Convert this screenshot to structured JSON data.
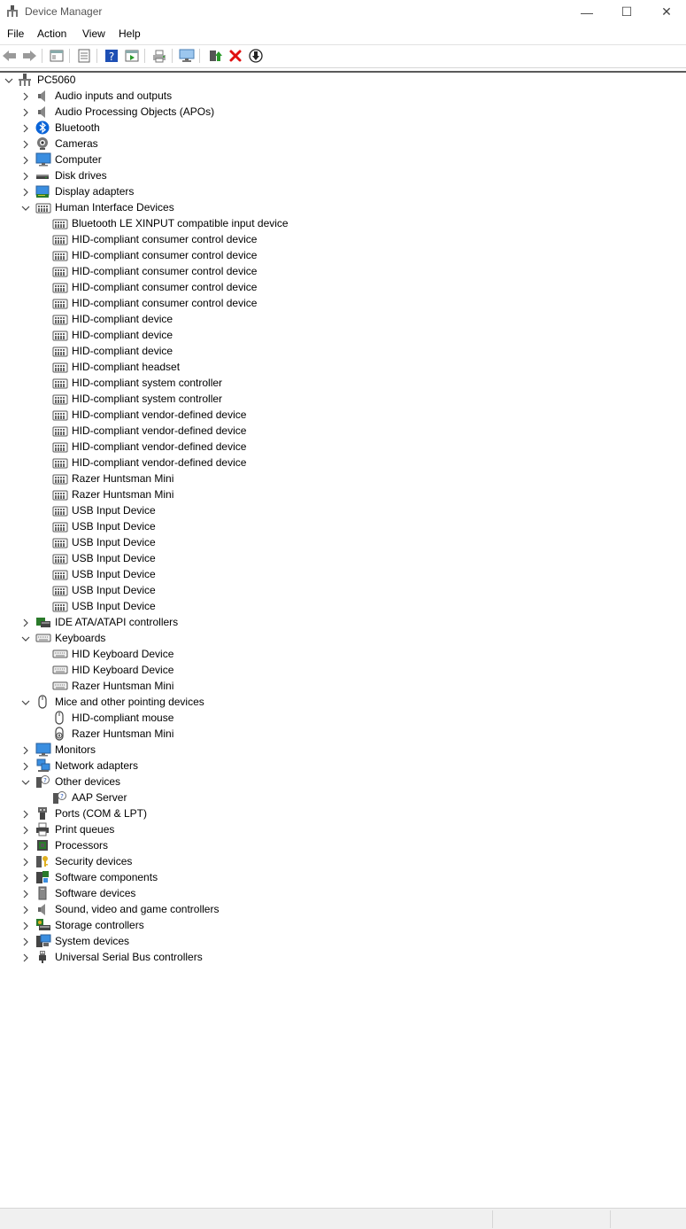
{
  "window": {
    "title": "Device Manager",
    "minimize_glyph": "—",
    "maximize_glyph": "☐",
    "close_glyph": "✕"
  },
  "menu": [
    "File",
    "Action",
    "View",
    "Help"
  ],
  "toolbar_icons": [
    "back-icon",
    "forward-icon",
    "|",
    "properties-view-icon",
    "|",
    "update-list-icon",
    "|",
    "help-icon",
    "run-icon",
    "|",
    "print-icon",
    "|",
    "scan-hardware-icon",
    "|",
    "update-driver-icon",
    "uninstall-icon",
    "disable-icon"
  ],
  "colors": {
    "uninstall": "#e01010",
    "accent": "#0a64d8"
  },
  "tree": [
    {
      "label": "PC5060",
      "level": 0,
      "expand": "open",
      "icon": "computer-root-icon"
    },
    {
      "label": "Audio inputs and outputs",
      "level": 1,
      "expand": "closed",
      "icon": "speaker-icon"
    },
    {
      "label": "Audio Processing Objects (APOs)",
      "level": 1,
      "expand": "closed",
      "icon": "speaker-icon"
    },
    {
      "label": "Bluetooth",
      "level": 1,
      "expand": "closed",
      "icon": "bluetooth-icon"
    },
    {
      "label": "Cameras",
      "level": 1,
      "expand": "closed",
      "icon": "camera-icon"
    },
    {
      "label": "Computer",
      "level": 1,
      "expand": "closed",
      "icon": "monitor-icon"
    },
    {
      "label": "Disk drives",
      "level": 1,
      "expand": "closed",
      "icon": "disk-icon"
    },
    {
      "label": "Display adapters",
      "level": 1,
      "expand": "closed",
      "icon": "display-adapter-icon"
    },
    {
      "label": "Human Interface Devices",
      "level": 1,
      "expand": "open",
      "icon": "hid-icon"
    },
    {
      "label": "Bluetooth LE XINPUT compatible input device",
      "level": 2,
      "icon": "hid-icon"
    },
    {
      "label": "HID-compliant consumer control device",
      "level": 2,
      "icon": "hid-icon"
    },
    {
      "label": "HID-compliant consumer control device",
      "level": 2,
      "icon": "hid-icon"
    },
    {
      "label": "HID-compliant consumer control device",
      "level": 2,
      "icon": "hid-icon"
    },
    {
      "label": "HID-compliant consumer control device",
      "level": 2,
      "icon": "hid-icon"
    },
    {
      "label": "HID-compliant consumer control device",
      "level": 2,
      "icon": "hid-icon"
    },
    {
      "label": "HID-compliant device",
      "level": 2,
      "icon": "hid-icon"
    },
    {
      "label": "HID-compliant device",
      "level": 2,
      "icon": "hid-icon"
    },
    {
      "label": "HID-compliant device",
      "level": 2,
      "icon": "hid-icon"
    },
    {
      "label": "HID-compliant headset",
      "level": 2,
      "icon": "hid-icon"
    },
    {
      "label": "HID-compliant system controller",
      "level": 2,
      "icon": "hid-icon"
    },
    {
      "label": "HID-compliant system controller",
      "level": 2,
      "icon": "hid-icon"
    },
    {
      "label": "HID-compliant vendor-defined device",
      "level": 2,
      "icon": "hid-icon"
    },
    {
      "label": "HID-compliant vendor-defined device",
      "level": 2,
      "icon": "hid-icon"
    },
    {
      "label": "HID-compliant vendor-defined device",
      "level": 2,
      "icon": "hid-icon"
    },
    {
      "label": "HID-compliant vendor-defined device",
      "level": 2,
      "icon": "hid-icon"
    },
    {
      "label": "Razer Huntsman Mini",
      "level": 2,
      "icon": "hid-icon"
    },
    {
      "label": "Razer Huntsman Mini",
      "level": 2,
      "icon": "hid-icon"
    },
    {
      "label": "USB Input Device",
      "level": 2,
      "icon": "hid-icon"
    },
    {
      "label": "USB Input Device",
      "level": 2,
      "icon": "hid-icon"
    },
    {
      "label": "USB Input Device",
      "level": 2,
      "icon": "hid-icon"
    },
    {
      "label": "USB Input Device",
      "level": 2,
      "icon": "hid-icon"
    },
    {
      "label": "USB Input Device",
      "level": 2,
      "icon": "hid-icon"
    },
    {
      "label": "USB Input Device",
      "level": 2,
      "icon": "hid-icon"
    },
    {
      "label": "USB Input Device",
      "level": 2,
      "icon": "hid-icon"
    },
    {
      "label": "IDE ATA/ATAPI controllers",
      "level": 1,
      "expand": "closed",
      "icon": "ide-icon"
    },
    {
      "label": "Keyboards",
      "level": 1,
      "expand": "open",
      "icon": "keyboard-icon"
    },
    {
      "label": "HID Keyboard Device",
      "level": 2,
      "icon": "keyboard-icon"
    },
    {
      "label": "HID Keyboard Device",
      "level": 2,
      "icon": "keyboard-icon"
    },
    {
      "label": "Razer Huntsman Mini",
      "level": 2,
      "icon": "keyboard-icon"
    },
    {
      "label": "Mice and other pointing devices",
      "level": 1,
      "expand": "open",
      "icon": "mouse-icon"
    },
    {
      "label": "HID-compliant mouse",
      "level": 2,
      "icon": "mouse-icon"
    },
    {
      "label": "Razer Huntsman Mini",
      "level": 2,
      "icon": "mouse-warning-icon"
    },
    {
      "label": "Monitors",
      "level": 1,
      "expand": "closed",
      "icon": "monitor-icon"
    },
    {
      "label": "Network adapters",
      "level": 1,
      "expand": "closed",
      "icon": "network-icon"
    },
    {
      "label": "Other devices",
      "level": 1,
      "expand": "open",
      "icon": "unknown-device-icon"
    },
    {
      "label": "AAP Server",
      "level": 2,
      "icon": "unknown-device-icon"
    },
    {
      "label": "Ports (COM & LPT)",
      "level": 1,
      "expand": "closed",
      "icon": "port-icon"
    },
    {
      "label": "Print queues",
      "level": 1,
      "expand": "closed",
      "icon": "printer-icon"
    },
    {
      "label": "Processors",
      "level": 1,
      "expand": "closed",
      "icon": "processor-icon"
    },
    {
      "label": "Security devices",
      "level": 1,
      "expand": "closed",
      "icon": "security-key-icon"
    },
    {
      "label": "Software components",
      "level": 1,
      "expand": "closed",
      "icon": "software-component-icon"
    },
    {
      "label": "Software devices",
      "level": 1,
      "expand": "closed",
      "icon": "software-device-icon"
    },
    {
      "label": "Sound, video and game controllers",
      "level": 1,
      "expand": "closed",
      "icon": "speaker-icon"
    },
    {
      "label": "Storage controllers",
      "level": 1,
      "expand": "closed",
      "icon": "storage-controller-icon"
    },
    {
      "label": "System devices",
      "level": 1,
      "expand": "closed",
      "icon": "system-device-icon"
    },
    {
      "label": "Universal Serial Bus controllers",
      "level": 1,
      "expand": "closed",
      "icon": "usb-icon"
    }
  ]
}
